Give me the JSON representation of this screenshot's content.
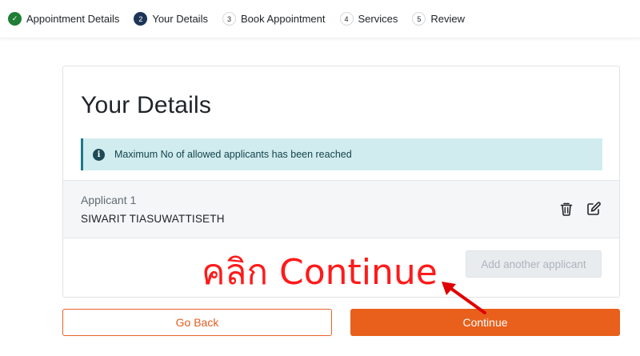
{
  "stepper": {
    "steps": [
      {
        "marker": "✓",
        "label": "Appointment Details",
        "state": "done"
      },
      {
        "marker": "2",
        "label": "Your Details",
        "state": "active"
      },
      {
        "marker": "3",
        "label": "Book Appointment",
        "state": "pending"
      },
      {
        "marker": "4",
        "label": "Services",
        "state": "pending"
      },
      {
        "marker": "5",
        "label": "Review",
        "state": "pending"
      }
    ]
  },
  "card": {
    "title": "Your Details",
    "alert": {
      "icon": "info-icon",
      "icon_glyph": "i",
      "text": "Maximum No of allowed applicants has been reached"
    },
    "applicant": {
      "label": "Applicant 1",
      "name": "SIWARIT TIASUWATTISETH",
      "actions": [
        "trash-icon",
        "edit-icon"
      ]
    },
    "add_button_label": "Add another applicant"
  },
  "footer": {
    "back_label": "Go Back",
    "continue_label": "Continue"
  },
  "annotation": {
    "text": "คลิก Continue",
    "color": "#ff1a1a"
  },
  "colors": {
    "accent": "#e8601c",
    "step_done": "#1e7e34",
    "step_active": "#1d3557",
    "alert_bg": "#d1ecef"
  }
}
